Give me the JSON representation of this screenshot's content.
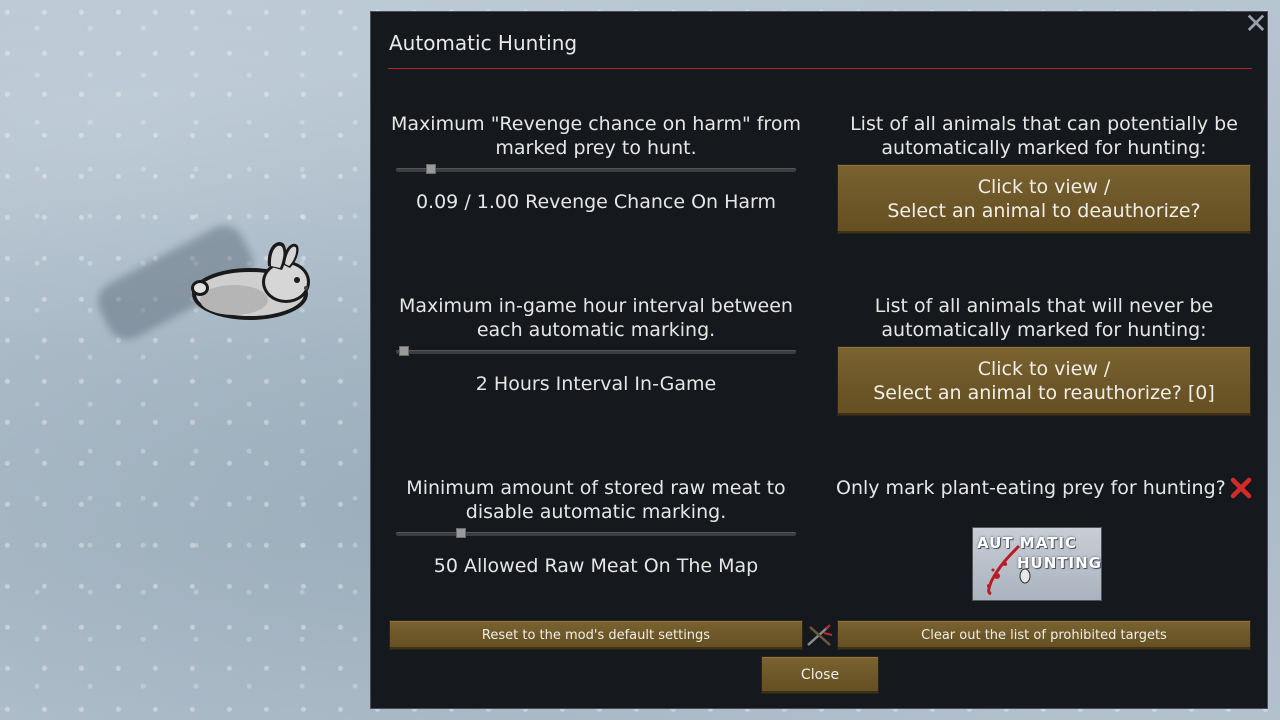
{
  "dialog": {
    "title": "Automatic Hunting",
    "close_glyph": "✕"
  },
  "settings": {
    "revenge": {
      "label": "Maximum \"Revenge chance on harm\" from marked prey to hunt.",
      "value_text": "0.09 / 1.00 Revenge Chance On Harm",
      "value": 0.09,
      "max": 1.0
    },
    "interval": {
      "label": "Maximum in-game hour interval between each automatic marking.",
      "value_text": "2 Hours Interval In-Game",
      "value": 2
    },
    "meat": {
      "label": "Minimum amount of stored raw meat to disable automatic marking.",
      "value_text": "50 Allowed Raw Meat On The Map",
      "value": 50
    }
  },
  "lists": {
    "potential": {
      "label": "List of all animals that can potentially be automatically marked for hunting:",
      "button_line1": "Click to view /",
      "button_line2": "Select an animal to deauthorize?"
    },
    "never": {
      "label": "List of all animals that will never be automatically marked for hunting:",
      "button_line1": "Click to view /",
      "button_line2": "Select an animal to reauthorize? [0]"
    }
  },
  "plant_eating": {
    "label": "Only mark plant-eating prey for hunting?",
    "checked": false,
    "icon": "red-x-icon",
    "color": "#d42a2a"
  },
  "logo": {
    "line1": "AUT MATIC",
    "line2": "HUNTING"
  },
  "footer": {
    "reset_label": "Reset to the mod's default settings",
    "clear_label": "Clear out the list of prohibited targets",
    "close_label": "Close"
  },
  "colors": {
    "dialog_bg": "#15181d",
    "accent_rule": "#b3262b",
    "button_wood": "#6e5829"
  }
}
